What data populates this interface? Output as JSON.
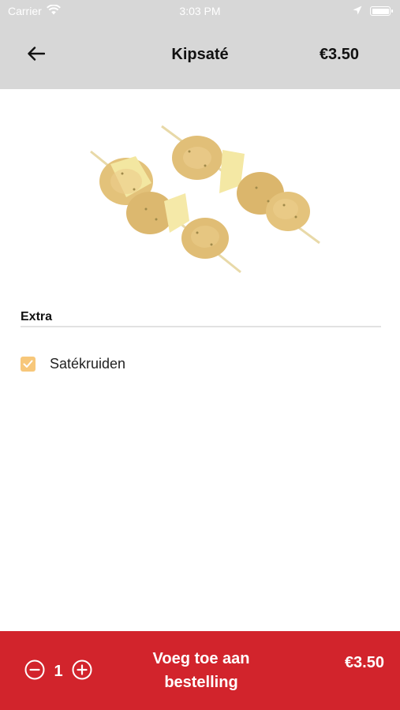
{
  "status_bar": {
    "carrier": "Carrier",
    "time": "3:03 PM",
    "icons": [
      "wifi-icon",
      "location-icon",
      "battery-icon"
    ]
  },
  "nav": {
    "title": "Kipsaté",
    "price": "€3.50",
    "back_icon": "arrow-left-icon"
  },
  "product": {
    "image_icon": "chicken-skewers-image"
  },
  "extras": {
    "section_title": "Extra",
    "options": [
      {
        "label": "Satékruiden",
        "checked": true
      }
    ]
  },
  "bottom_bar": {
    "quantity": "1",
    "add_label_line1": "Voeg toe aan",
    "add_label_line2": "bestelling",
    "price": "€3.50",
    "decrement_icon": "minus-circle-icon",
    "increment_icon": "plus-circle-icon"
  },
  "colors": {
    "header_bg": "#d7d7d7",
    "accent_red": "#d2242c",
    "checkbox_orange": "#f7c77a",
    "divider": "#e2e2e2"
  }
}
